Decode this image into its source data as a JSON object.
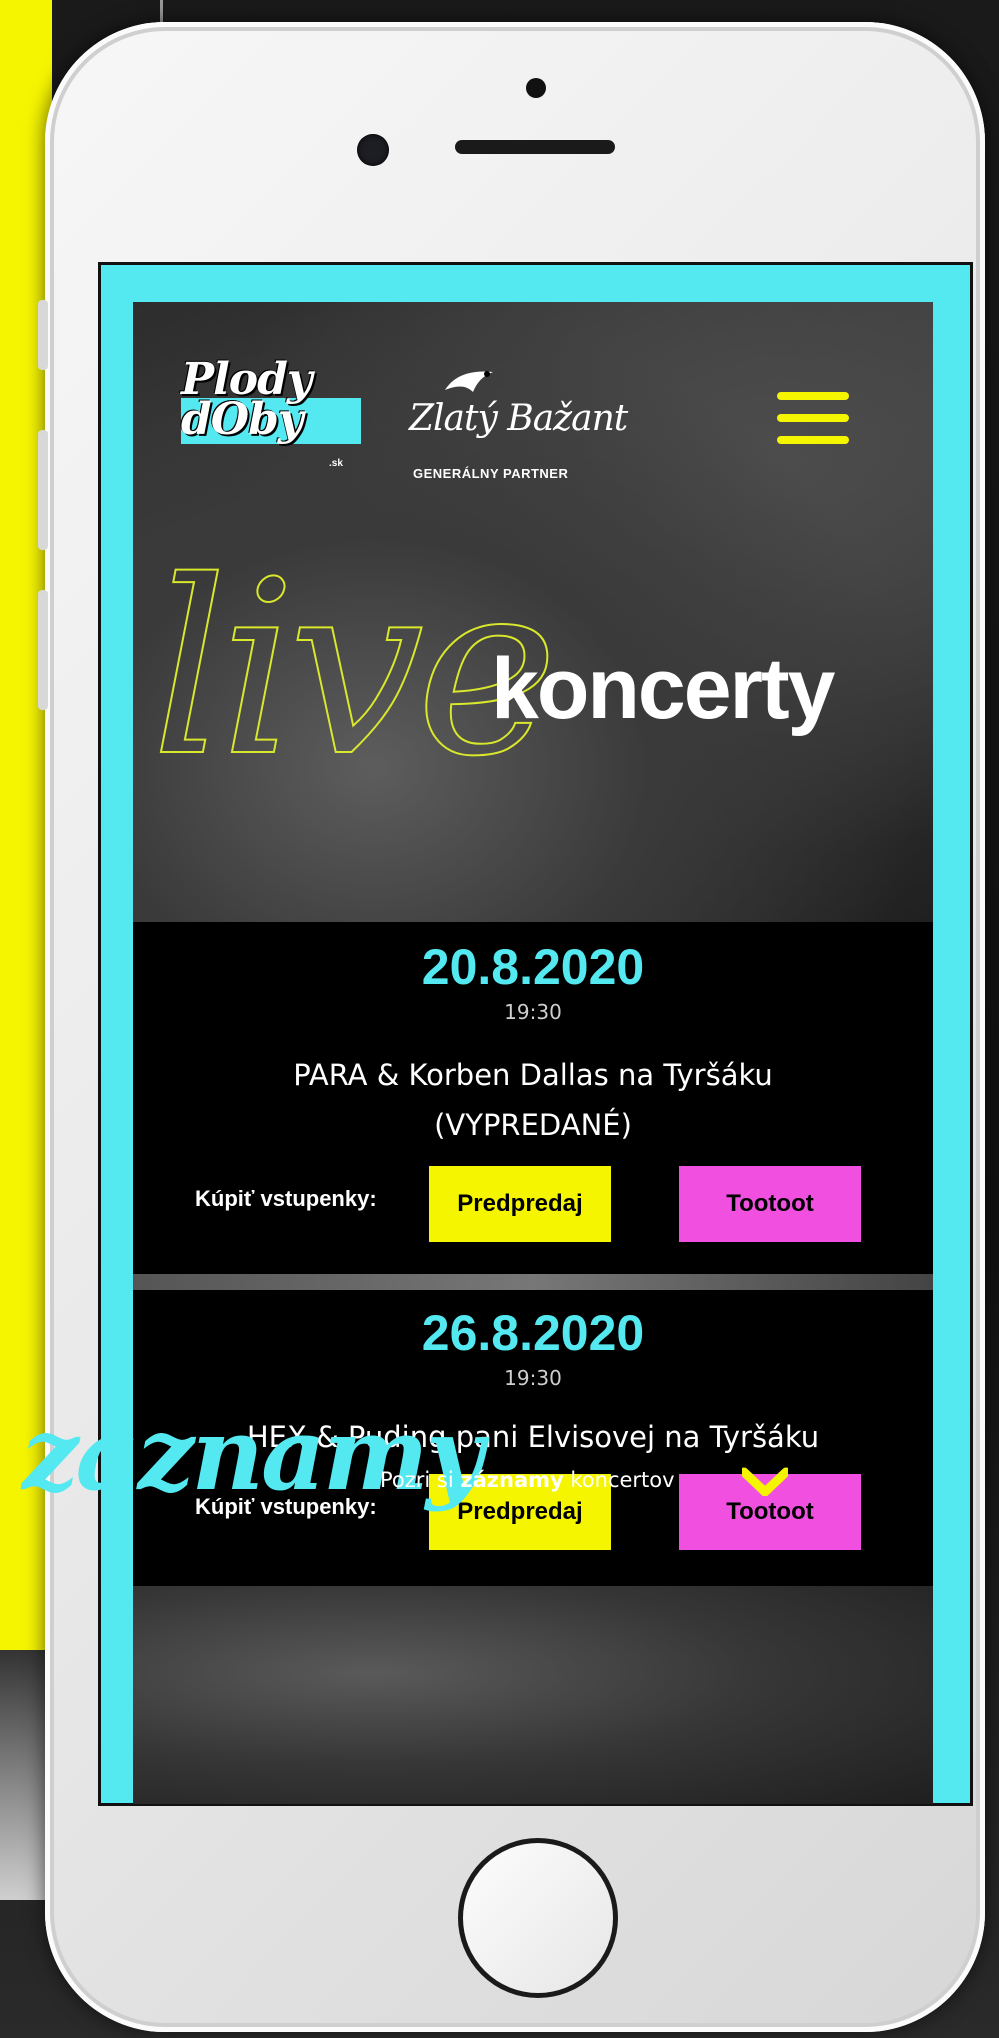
{
  "brand": {
    "logo_text": "Plody dOby",
    "logo_suffix": ".sk",
    "partner_name": "Zlatý Bažant",
    "partner_label": "GENERÁLNY PARTNER"
  },
  "hero": {
    "script_word": "live",
    "heading": "koncerty"
  },
  "events": [
    {
      "date": "20.8.2020",
      "time": "19:30",
      "title_line1": "PARA & Korben Dallas na Tyršáku",
      "title_line2": "(VYPREDANÉ)",
      "buy_label": "Kúpiť vstupenky:",
      "btn1": "Predpredaj",
      "btn2": "Tootoot"
    },
    {
      "date": "26.8.2020",
      "time": "19:30",
      "title_line1": "HEX & Puding pani Elvisovej na Tyršáku",
      "buy_label": "Kúpiť vstupenky:",
      "btn1": "Predpredaj",
      "btn2": "Tootoot"
    }
  ],
  "recordings": {
    "heading": "záznamy",
    "link_prefix": "Pozri si ",
    "link_bold": "záznamy",
    "link_suffix": " koncertov"
  },
  "icons": {
    "menu": "hamburger-menu-icon",
    "scroll": "chevron-down-icon"
  },
  "colors": {
    "cyan": "#54e8f0",
    "yellow": "#f6f500",
    "magenta": "#f04fe0"
  }
}
